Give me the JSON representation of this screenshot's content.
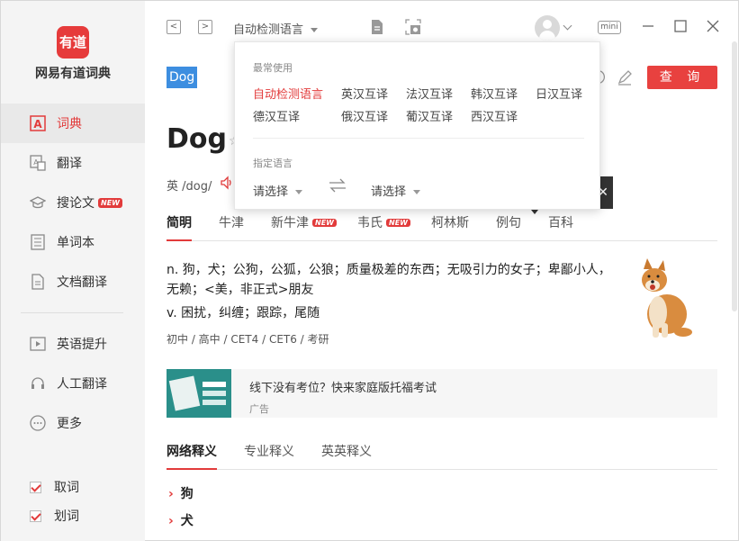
{
  "sidebar": {
    "logo_text": "有道",
    "brand": "网易有道词典",
    "items": [
      {
        "label": "词典",
        "active": true
      },
      {
        "label": "翻译"
      },
      {
        "label": "搜论文",
        "badge": "NEW"
      },
      {
        "label": "单词本"
      },
      {
        "label": "文档翻译"
      }
    ],
    "items2": [
      {
        "label": "英语提升"
      },
      {
        "label": "人工翻译"
      },
      {
        "label": "更多"
      }
    ],
    "checks": [
      {
        "label": "取词",
        "checked": true
      },
      {
        "label": "划词",
        "checked": true
      }
    ]
  },
  "topbar": {
    "back": "<",
    "forward": ">",
    "language_select": "自动检测语言",
    "mini": "mini"
  },
  "search": {
    "query": "Dog",
    "button": "查 询"
  },
  "entry": {
    "word": "Dog",
    "star": "☆",
    "phonetic": "英 /dog/"
  },
  "dict_tabs": [
    {
      "label": "简明",
      "active": true
    },
    {
      "label": "牛津"
    },
    {
      "label": "新牛津",
      "badge": "NEW"
    },
    {
      "label": "韦氏",
      "badge": "NEW"
    },
    {
      "label": "柯林斯"
    },
    {
      "label": "例句"
    },
    {
      "label": "百科"
    }
  ],
  "definitions": [
    "n. 狗，犬；公狗，公狐，公狼；质量极差的东西；无吸引力的女子；卑鄙小人，无赖；<美，非正式>朋友",
    "v. 困扰，纠缠；跟踪，尾随"
  ],
  "levels": "初中 / 高中 / CET4 / CET6 / 考研",
  "ad": {
    "title": "线下没有考位？快来家庭版托福考试",
    "tag": "广告"
  },
  "sub_tabs": [
    {
      "label": "网络释义",
      "active": true
    },
    {
      "label": "专业释义"
    },
    {
      "label": "英英释义"
    }
  ],
  "net_items": [
    "狗",
    "犬"
  ],
  "popup": {
    "common_heading": "最常使用",
    "options": [
      "自动检测语言",
      "英汉互译",
      "法汉互译",
      "韩汉互译",
      "日汉互译",
      "德汉互译",
      "俄汉互译",
      "葡汉互译",
      "西汉互译"
    ],
    "specify_heading": "指定语言",
    "from_select": "请选择",
    "to_select": "请选择"
  },
  "colors": {
    "accent": "#e23b3b",
    "selection": "#3d8ee0"
  }
}
